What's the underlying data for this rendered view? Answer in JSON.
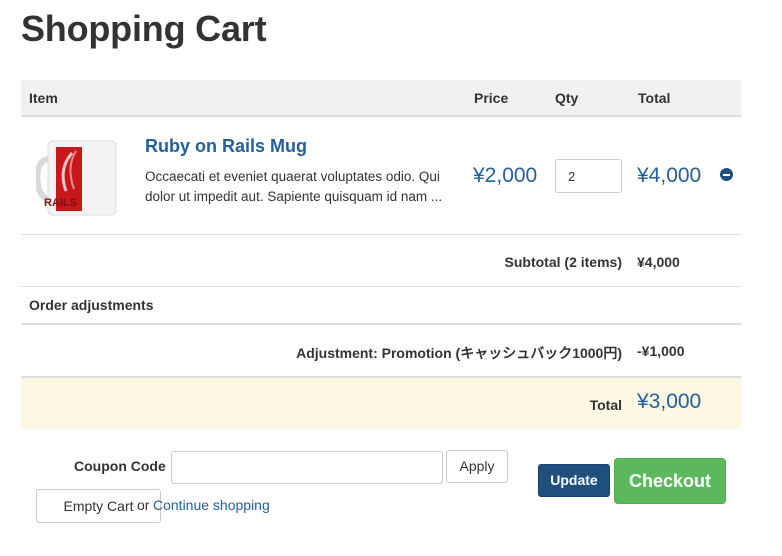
{
  "page": {
    "title": "Shopping Cart"
  },
  "table": {
    "headers": {
      "item": "Item",
      "price": "Price",
      "qty": "Qty",
      "total": "Total"
    }
  },
  "line_items": [
    {
      "name": "Ruby on Rails Mug",
      "description": "Occaecati et eveniet quaerat voluptates odio. Qui dolor ut impedit aut. Sapiente quisquam id nam ...",
      "price": "¥2,000",
      "quantity": "2",
      "total": "¥4,000",
      "image_text": "RAILS",
      "remove_icon": "minus-circle-icon"
    }
  ],
  "subtotal": {
    "label": "Subtotal (2 items)",
    "value": "¥4,000"
  },
  "adjustments": {
    "heading": "Order adjustments",
    "items": [
      {
        "label": "Adjustment: Promotion (キャッシュバック1000円)",
        "value": "-¥1,000"
      }
    ]
  },
  "total": {
    "label": "Total",
    "value": "¥3,000"
  },
  "coupon": {
    "label": "Coupon Code",
    "value": "",
    "apply_label": "Apply"
  },
  "actions": {
    "empty_cart": "Empty Cart",
    "or_text": "or",
    "continue_shopping": "Continue shopping",
    "update": "Update",
    "checkout": "Checkout"
  },
  "colors": {
    "link": "#23609c",
    "checkout": "#5cb85c",
    "update": "#1f4f7c",
    "total_row_bg": "#fcf8e3",
    "header_bg": "#f1f1f1"
  }
}
